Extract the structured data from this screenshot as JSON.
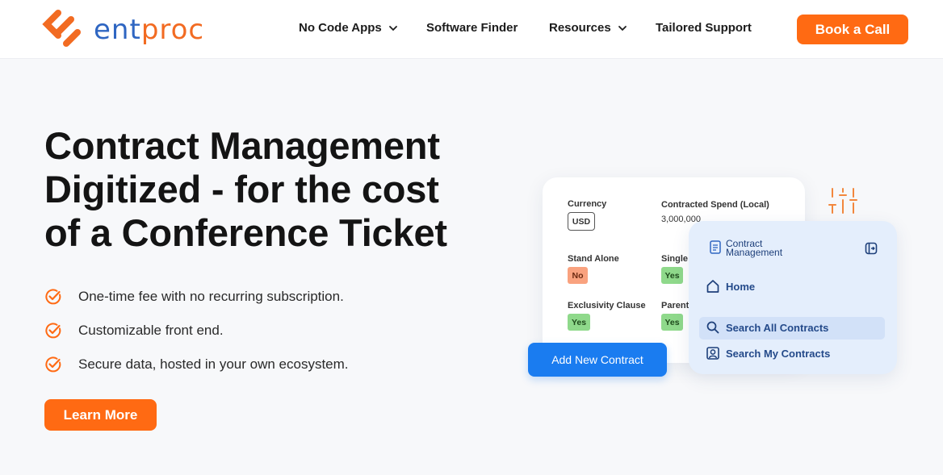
{
  "brand": {
    "name_part1": "ent",
    "name_part2": "proc",
    "logo_icon": "entproc-chevron-logo",
    "color_orange": "#f26b22",
    "color_blue": "#2f66c2"
  },
  "nav": {
    "items": [
      {
        "label": "No Code Apps",
        "has_dropdown": true
      },
      {
        "label": "Software Finder",
        "has_dropdown": false
      },
      {
        "label": "Resources",
        "has_dropdown": true
      },
      {
        "label": "Tailored Support",
        "has_dropdown": false
      }
    ],
    "cta_label": "Book a Call"
  },
  "hero": {
    "title_lines": [
      "Contract Management",
      "Digitized - for the cost",
      "of a Conference Ticket"
    ],
    "features": [
      "One-time fee with no recurring subscription.",
      "Customizable front end.",
      "Secure data, hosted in your own ecosystem."
    ],
    "feature_icon": "check-circle-icon",
    "button_label": "Learn More",
    "accent": "#ff6a13"
  },
  "mockup": {
    "fields": {
      "currency_label": "Currency",
      "currency_value": "USD",
      "spend_label": "Contracted Spend (Local)",
      "spend_value": "3,000,000",
      "standalone_label": "Stand Alone",
      "standalone_value": "No",
      "single_label": "Single S",
      "single_value": "Yes",
      "exclusivity_label": "Exclusivity Clause",
      "exclusivity_value": "Yes",
      "parent_label": "Parent",
      "parent_value": "Yes"
    },
    "panel": {
      "title_line1": "Contract",
      "title_line2": "Management",
      "items": [
        {
          "label": "Home",
          "icon": "home-icon"
        },
        {
          "label": "Search All Contracts",
          "icon": "search-icon"
        },
        {
          "label": "Search My Contracts",
          "icon": "user-search-icon"
        }
      ]
    },
    "add_button_label": "Add New Contract",
    "blue": "#1a7cf0"
  }
}
